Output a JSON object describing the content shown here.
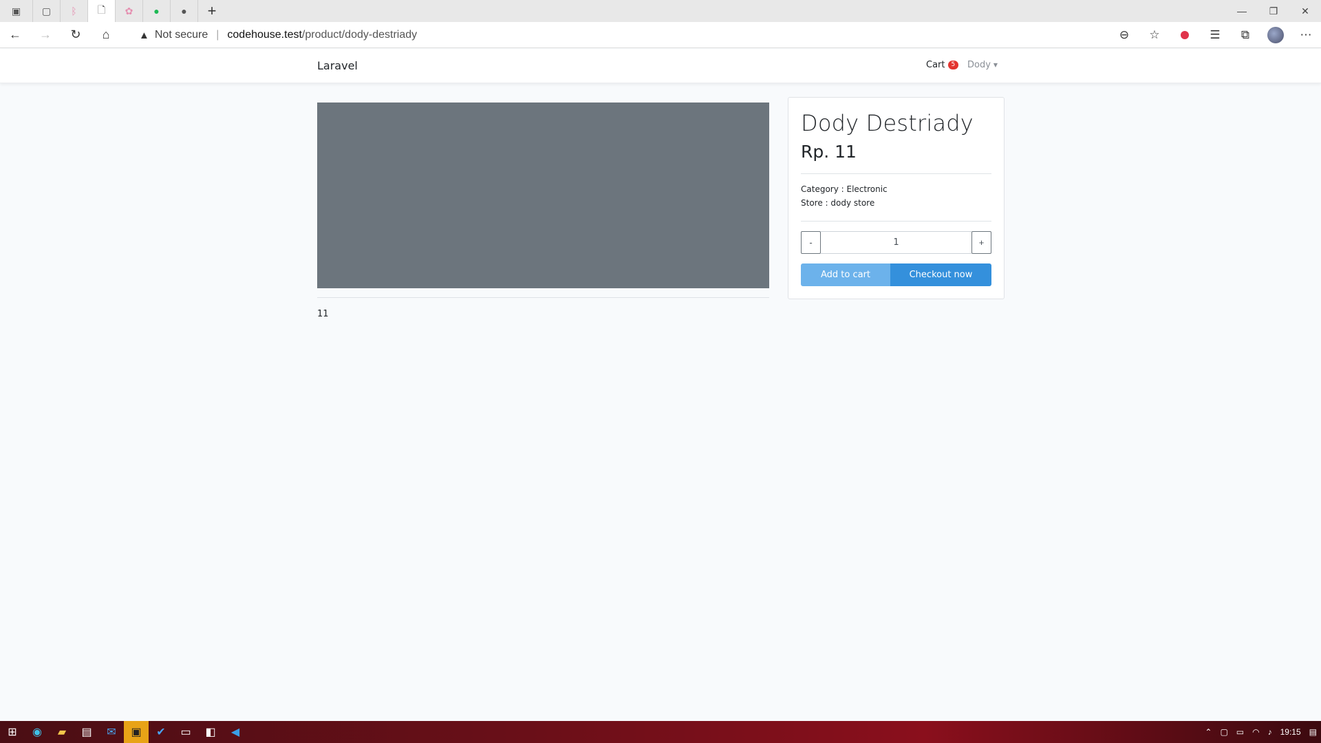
{
  "browser": {
    "address": {
      "security_icon": "warning-icon",
      "security_label": "Not secure",
      "host": "codehouse.test",
      "path": "/product/dody-destriady"
    }
  },
  "navbar": {
    "brand": "Laravel",
    "cart_label": "Cart",
    "cart_count": "5",
    "user_name": "Dody"
  },
  "product": {
    "image_color": "#6c757d",
    "description": "11",
    "title": "Dody Destriady",
    "price": "Rp. 11",
    "category": "Category : Electronic",
    "store": "Store : dody store",
    "quantity": {
      "minus": "-",
      "value": "1",
      "plus": "+"
    },
    "add_to_cart_label": "Add to cart",
    "checkout_label": "Checkout now"
  },
  "taskbar": {
    "time": "19:15"
  },
  "colors": {
    "primary": "#3490dc",
    "primary_light": "#6cb2eb",
    "danger": "#e3342f",
    "page_bg": "#f8fafc"
  }
}
